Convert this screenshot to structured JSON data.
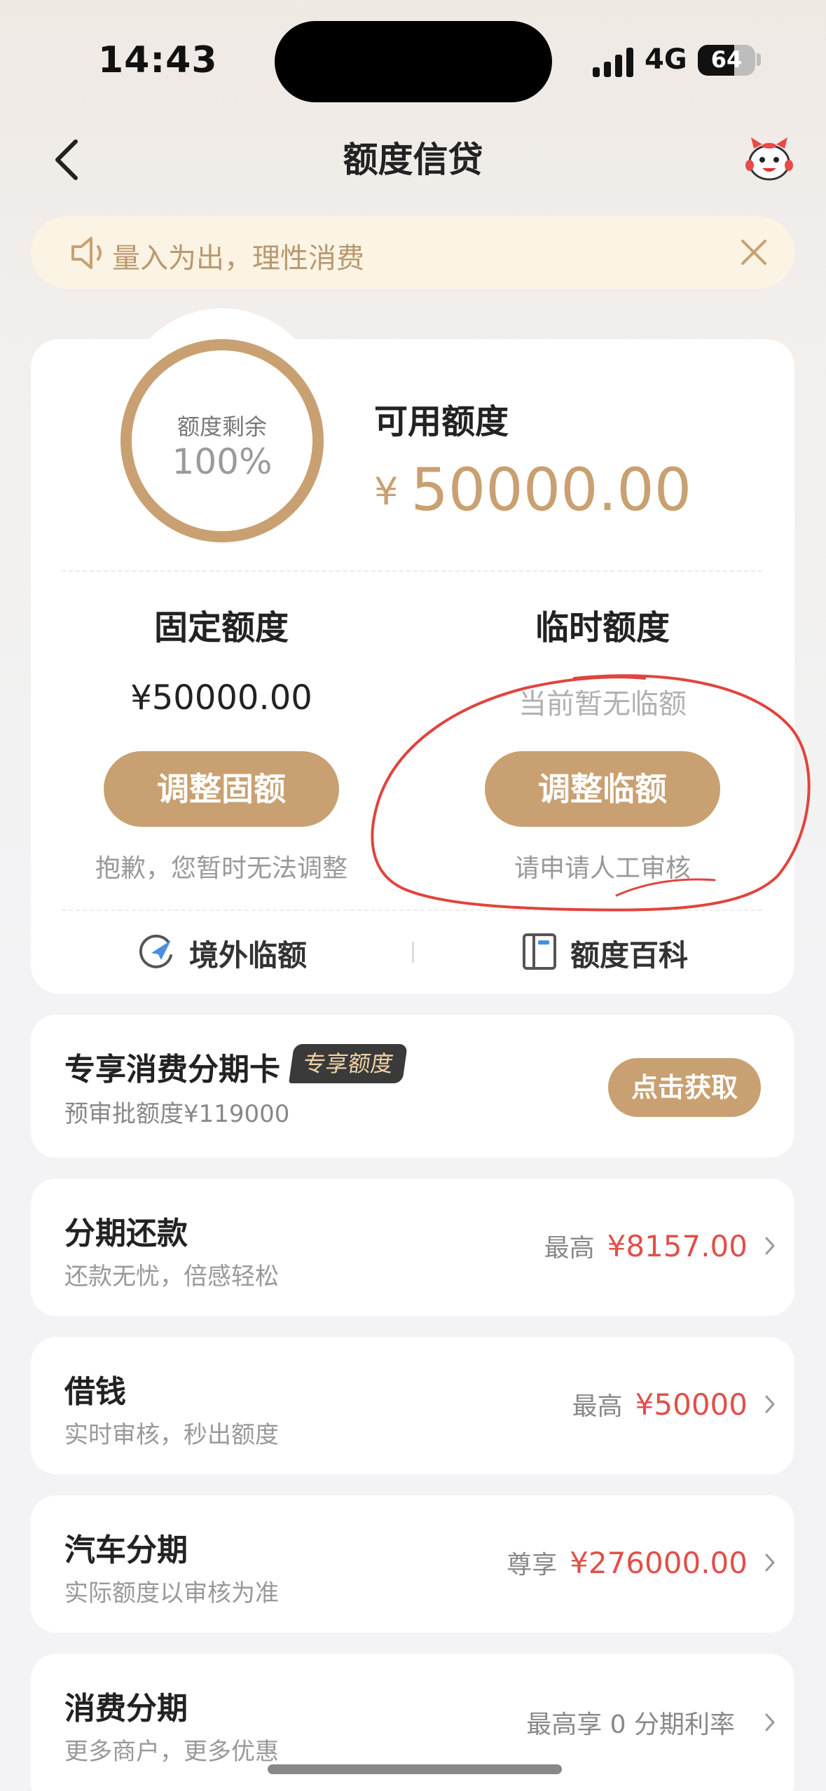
{
  "status": {
    "time": "14:43",
    "network": "4G",
    "battery": "64"
  },
  "nav": {
    "title": "额度信贷"
  },
  "notice": {
    "text": "量入为出，理性消费"
  },
  "credit": {
    "ring_label": "额度剩余",
    "ring_percent": "100%",
    "available_label": "可用额度",
    "currency": "¥",
    "available_amount": "50000.00",
    "fixed": {
      "title": "固定额度",
      "amount": "¥50000.00",
      "button": "调整固额",
      "note": "抱歉，您暂时无法调整"
    },
    "temporary": {
      "title": "临时额度",
      "status": "当前暂无临额",
      "button": "调整临额",
      "note": "请申请人工审核"
    },
    "links": {
      "overseas": "境外临额",
      "wiki": "额度百科"
    }
  },
  "promo": {
    "title": "专享消费分期卡",
    "badge": "专享额度",
    "subtitle": "预审批额度¥119000",
    "button": "点击获取"
  },
  "items": [
    {
      "title": "分期还款",
      "subtitle": "还款无忧，倍感轻松",
      "prefix": "最高",
      "value": "¥8157.00"
    },
    {
      "title": "借钱",
      "subtitle": "实时审核，秒出额度",
      "prefix": "最高",
      "value": "¥50000"
    },
    {
      "title": "汽车分期",
      "subtitle": "实际额度以审核为准",
      "prefix": "尊享",
      "value": "¥276000.00"
    },
    {
      "title": "消费分期",
      "subtitle": "更多商户，更多优惠",
      "prefix": "最高享 0 分期利率",
      "value": ""
    }
  ],
  "colors": {
    "gold": "#c9a071",
    "red": "#e0504a",
    "annotation": "#e0443e"
  }
}
